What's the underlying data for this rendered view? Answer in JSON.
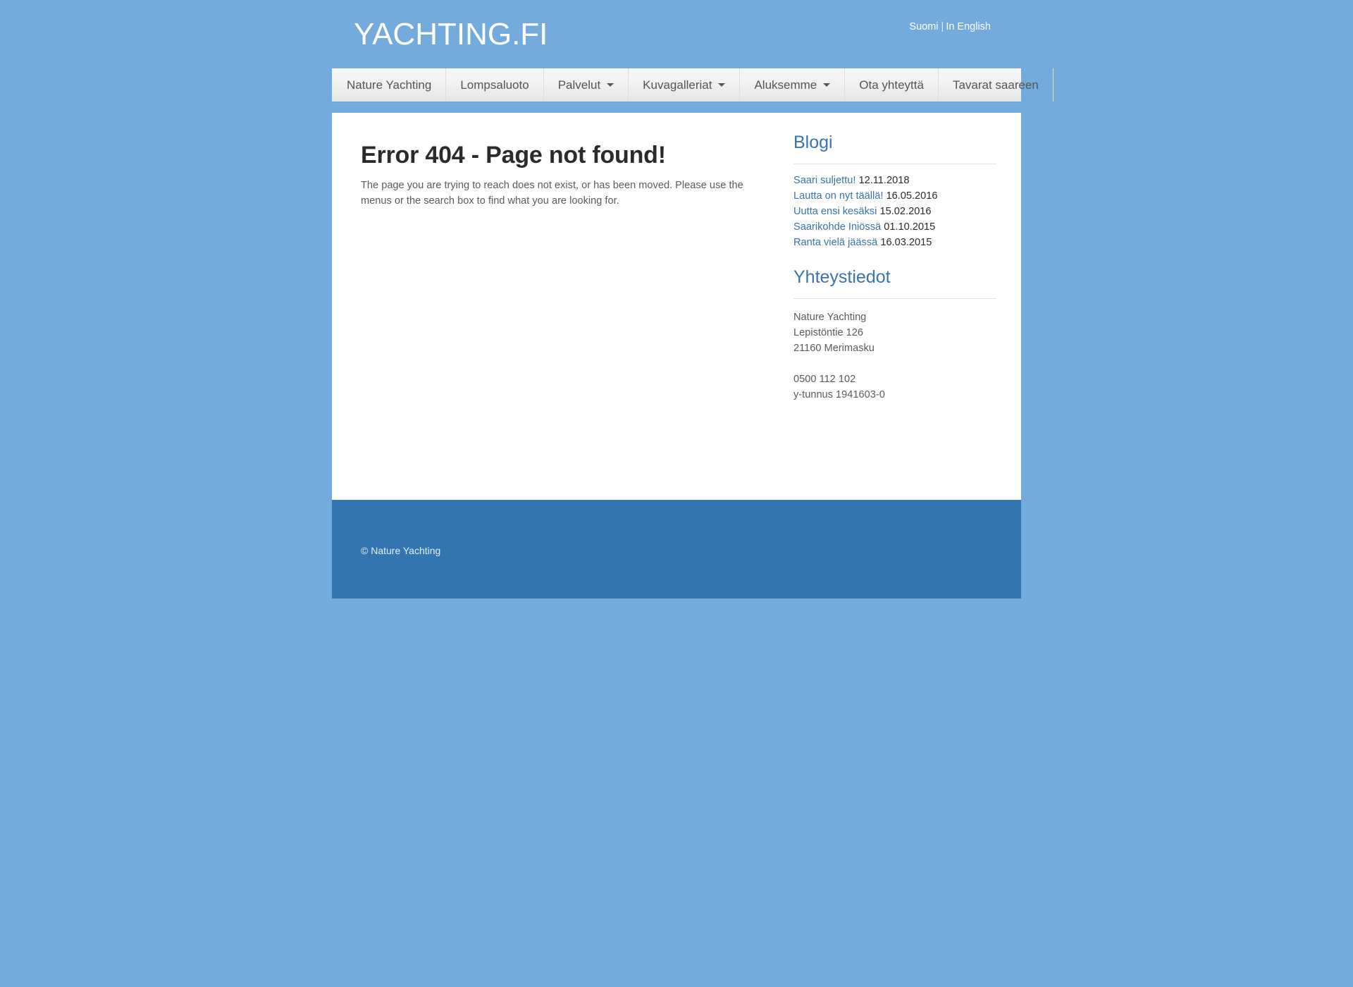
{
  "colors": {
    "page_background": "#73acdc",
    "panel_background": "#ffffff",
    "footer_background": "#3375b0",
    "link_blue": "#3a73ad",
    "nav_text": "#555555",
    "heading_dark": "#2b2b2b"
  },
  "header": {
    "site_title": "YACHTING.FI",
    "language": {
      "finnish_label": "Suomi",
      "separator": "|",
      "english_label": "In English"
    }
  },
  "nav": {
    "items": [
      {
        "label": "Nature Yachting",
        "has_dropdown": false
      },
      {
        "label": "Lompsaluoto",
        "has_dropdown": false
      },
      {
        "label": "Palvelut",
        "has_dropdown": true
      },
      {
        "label": "Kuvagalleriat",
        "has_dropdown": true
      },
      {
        "label": "Aluksemme",
        "has_dropdown": true
      },
      {
        "label": "Ota yhteyttä",
        "has_dropdown": false
      },
      {
        "label": "Tavarat saareen",
        "has_dropdown": false
      }
    ]
  },
  "main": {
    "error_title": "Error 404 - Page not found!",
    "error_body": "The page you are trying to reach does not exist, or has been moved. Please use the menus or the search box to find what you are looking for."
  },
  "sidebar": {
    "blog": {
      "heading": "Blogi",
      "entries": [
        {
          "title": "Saari suljettu!",
          "date": "12.11.2018"
        },
        {
          "title": "Lautta on nyt täällä!",
          "date": "16.05.2016"
        },
        {
          "title": "Uutta ensi kesäksi",
          "date": "15.02.2016"
        },
        {
          "title": "Saarikohde Iniössä",
          "date": "01.10.2015"
        },
        {
          "title": "Ranta vielä jäässä",
          "date": "16.03.2015"
        }
      ]
    },
    "contact": {
      "heading": "Yhteystiedot",
      "company": "Nature Yachting",
      "street": "Lepistöntie 126",
      "city": "21160 Merimasku",
      "phone": "0500 112 102",
      "business_id": "y-tunnus 1941603-0"
    }
  },
  "footer": {
    "copyright": "© Nature Yachting"
  }
}
